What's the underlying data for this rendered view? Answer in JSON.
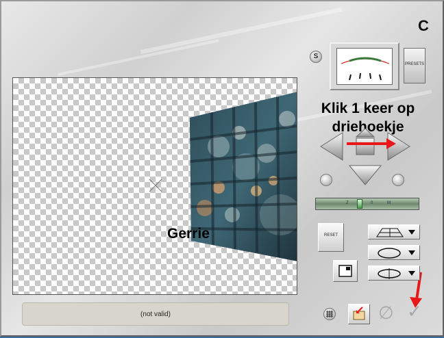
{
  "preview": {
    "watermark": "Gerrie"
  },
  "instruction": {
    "line1": "Klik 1 keer op",
    "line2": "driehoekje"
  },
  "status": {
    "text": "(not valid)"
  },
  "toolbar": {
    "s_label": "S",
    "presets_label": "PRESETS",
    "reset_label": "RESET",
    "logo_label": "C"
  },
  "slider": {
    "ticks": [
      "Z",
      "0",
      "M"
    ],
    "value_fraction": 0.42
  },
  "colors": {
    "red_arrow": "#e81818",
    "panel": "#d8d8d8"
  },
  "icons": {
    "ok": "checkmark-icon",
    "cancel": "null-set-icon",
    "grid": "grid-icon",
    "open": "folder-open-icon"
  }
}
